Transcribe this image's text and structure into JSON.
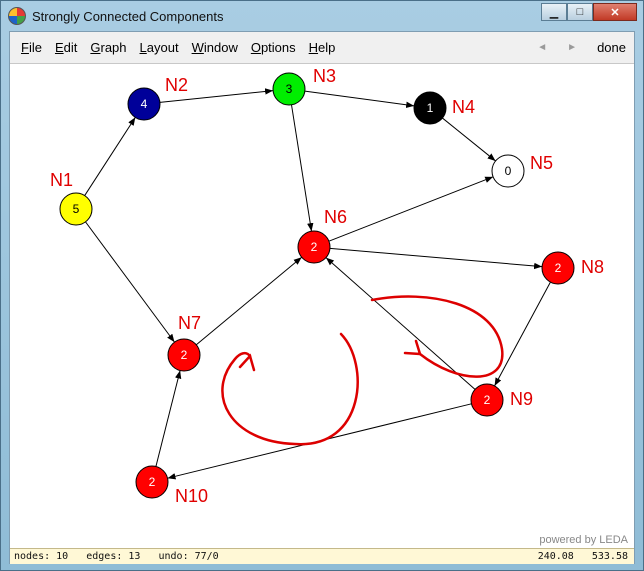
{
  "window": {
    "title": "Strongly Connected Components"
  },
  "menu": {
    "items": [
      {
        "first": "F",
        "rest": "ile"
      },
      {
        "first": "E",
        "rest": "dit"
      },
      {
        "first": "G",
        "rest": "raph"
      },
      {
        "first": "L",
        "rest": "ayout"
      },
      {
        "first": "W",
        "rest": "indow"
      },
      {
        "first": "O",
        "rest": "ptions"
      },
      {
        "first": "H",
        "rest": "elp"
      }
    ],
    "back_arrow": "◄",
    "forward_arrow": "►",
    "done_label": "done"
  },
  "graph": {
    "nodes": [
      {
        "id": "N1",
        "value": "5",
        "color": "#ffff00",
        "text_color": "#000000"
      },
      {
        "id": "N2",
        "value": "4",
        "color": "#000099",
        "text_color": "#ffffff"
      },
      {
        "id": "N3",
        "value": "3",
        "color": "#00ee00",
        "text_color": "#000000"
      },
      {
        "id": "N4",
        "value": "1",
        "color": "#000000",
        "text_color": "#ffffff"
      },
      {
        "id": "N5",
        "value": "0",
        "color": "#ffffff",
        "text_color": "#000000"
      },
      {
        "id": "N6",
        "value": "2",
        "color": "#ff0000",
        "text_color": "#ffffff"
      },
      {
        "id": "N7",
        "value": "2",
        "color": "#ff0000",
        "text_color": "#ffffff"
      },
      {
        "id": "N8",
        "value": "2",
        "color": "#ff0000",
        "text_color": "#ffffff"
      },
      {
        "id": "N9",
        "value": "2",
        "color": "#ff0000",
        "text_color": "#ffffff"
      },
      {
        "id": "N10",
        "value": "2",
        "color": "#ff0000",
        "text_color": "#ffffff"
      }
    ],
    "edges": [
      [
        "N1",
        "N2"
      ],
      [
        "N1",
        "N7"
      ],
      [
        "N2",
        "N3"
      ],
      [
        "N3",
        "N4"
      ],
      [
        "N3",
        "N6"
      ],
      [
        "N4",
        "N5"
      ],
      [
        "N6",
        "N5"
      ],
      [
        "N6",
        "N8"
      ],
      [
        "N7",
        "N6"
      ],
      [
        "N8",
        "N9"
      ],
      [
        "N9",
        "N6"
      ],
      [
        "N9",
        "N10"
      ],
      [
        "N10",
        "N7"
      ]
    ],
    "annotation_color": "#dd0000"
  },
  "footer": {
    "powered_by": "powered by LEDA"
  },
  "status": {
    "left": "nodes: 10   edges: 13   undo: 77/0",
    "right": "240.08   533.58"
  }
}
